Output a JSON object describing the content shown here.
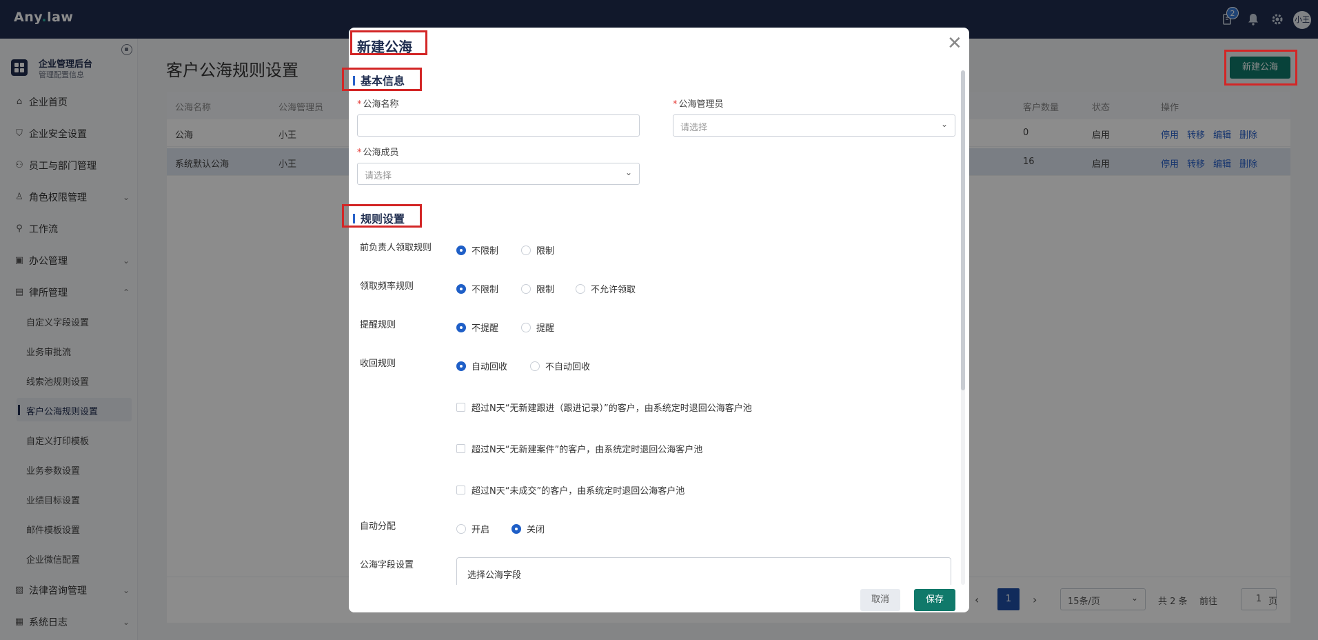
{
  "app": {
    "logo_text": "Any",
    "logo_dot": ".",
    "logo_text2": "law"
  },
  "topbar": {
    "notification_count": "2",
    "avatar_text": "小王"
  },
  "sidebar": {
    "org_title": "企业管理后台",
    "org_subtitle": "管理配置信息",
    "items": [
      {
        "label": "企业首页",
        "icon": "home-icon"
      },
      {
        "label": "企业安全设置",
        "icon": "shield-icon"
      },
      {
        "label": "员工与部门管理",
        "icon": "users-icon"
      },
      {
        "label": "角色权限管理",
        "icon": "role-icon"
      },
      {
        "label": "工作流",
        "icon": "workflow-icon"
      },
      {
        "label": "办公管理",
        "icon": "briefcase-icon"
      },
      {
        "label": "律所管理",
        "icon": "building-icon"
      },
      {
        "label": "法律咨询管理",
        "icon": "document-icon"
      },
      {
        "label": "系统日志",
        "icon": "log-icon"
      }
    ],
    "sub_items": [
      "自定义字段设置",
      "业务审批流",
      "线索池规则设置",
      "客户公海规则设置",
      "自定义打印模板",
      "业务参数设置",
      "业绩目标设置",
      "邮件模板设置",
      "企业微信配置"
    ]
  },
  "main": {
    "title": "客户公海规则设置",
    "new_button": "新建公海",
    "columns": [
      "公海名称",
      "公海管理员",
      "客户数量",
      "状态",
      "操作"
    ],
    "rows": [
      {
        "name": "公海",
        "admin": "小王",
        "count": "0",
        "status": "启用"
      },
      {
        "name": "系统默认公海",
        "admin": "小王",
        "count": "16",
        "status": "启用"
      }
    ],
    "ops": [
      "停用",
      "转移",
      "编辑",
      "删除"
    ]
  },
  "pagination": {
    "prev": "‹",
    "current": "1",
    "next": "›",
    "page_size": "15条/页",
    "total": "共 2 条",
    "goto_label": "前往",
    "goto_value": "1",
    "page_suffix": "页"
  },
  "modal": {
    "title": "新建公海",
    "section_basic": "基本信息",
    "name_label": "公海名称",
    "admin_label": "公海管理员",
    "admin_placeholder": "请选择",
    "members_label": "公海成员",
    "members_placeholder": "请选择",
    "section_rules": "规则设置",
    "rules": {
      "prev_owner_label": "前负责人领取规则",
      "prev_owner_opts": [
        "不限制",
        "限制"
      ],
      "freq_label": "领取频率规则",
      "freq_opts": [
        "不限制",
        "限制",
        "不允许领取"
      ],
      "remind_label": "提醒规则",
      "remind_opts": [
        "不提醒",
        "提醒"
      ],
      "recycle_label": "收回规则",
      "recycle_opts": [
        "自动回收",
        "不自动回收"
      ],
      "recycle_checks": [
        "超过N天“无新建跟进（跟进记录）”的客户，由系统定时退回公海客户池",
        "超过N天“无新建案件”的客户，由系统定时退回公海客户池",
        "超过N天“未成交”的客户，由系统定时退回公海客户池"
      ],
      "auto_assign_label": "自动分配",
      "auto_assign_opts": [
        "开启",
        "关闭"
      ],
      "fields_label": "公海字段设置",
      "fields_box": "选择公海字段"
    },
    "cancel": "取消",
    "save": "保存"
  }
}
